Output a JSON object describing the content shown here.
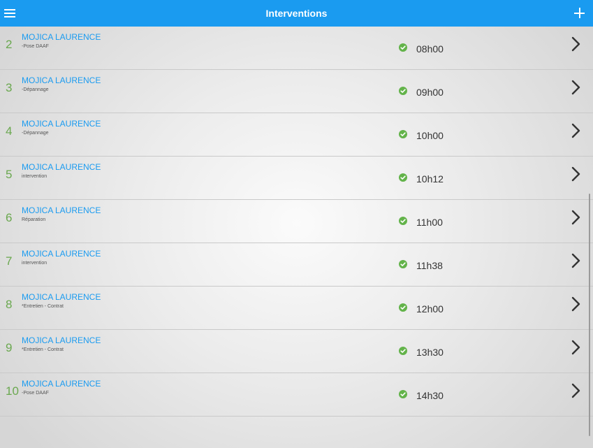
{
  "header": {
    "title": "Interventions",
    "menu_icon": "hamburger-icon",
    "add_icon": "plus-icon"
  },
  "colors": {
    "accent": "#1a9bf0",
    "number": "#6aa84f",
    "status_ok": "#63b34a"
  },
  "rows": [
    {
      "num": "2",
      "name": "MOJICA LAURENCE",
      "subtitle": "-Pose DAAF",
      "time": "08h00"
    },
    {
      "num": "3",
      "name": "MOJICA LAURENCE",
      "subtitle": "-Dépannage",
      "time": "09h00"
    },
    {
      "num": "4",
      "name": "MOJICA LAURENCE",
      "subtitle": "-Dépannage",
      "time": "10h00"
    },
    {
      "num": "5",
      "name": "MOJICA LAURENCE",
      "subtitle": "intervention",
      "time": "10h12"
    },
    {
      "num": "6",
      "name": "MOJICA LAURENCE",
      "subtitle": "Réparation",
      "time": "11h00"
    },
    {
      "num": "7",
      "name": "MOJICA LAURENCE",
      "subtitle": "intervention",
      "time": "11h38"
    },
    {
      "num": "8",
      "name": "MOJICA LAURENCE",
      "subtitle": "*Entretien - Contrat",
      "time": "12h00"
    },
    {
      "num": "9",
      "name": "MOJICA LAURENCE",
      "subtitle": "*Entretien - Contrat",
      "time": "13h30"
    },
    {
      "num": "10",
      "name": "MOJICA LAURENCE",
      "subtitle": "-Pose DAAF",
      "time": "14h30"
    }
  ]
}
